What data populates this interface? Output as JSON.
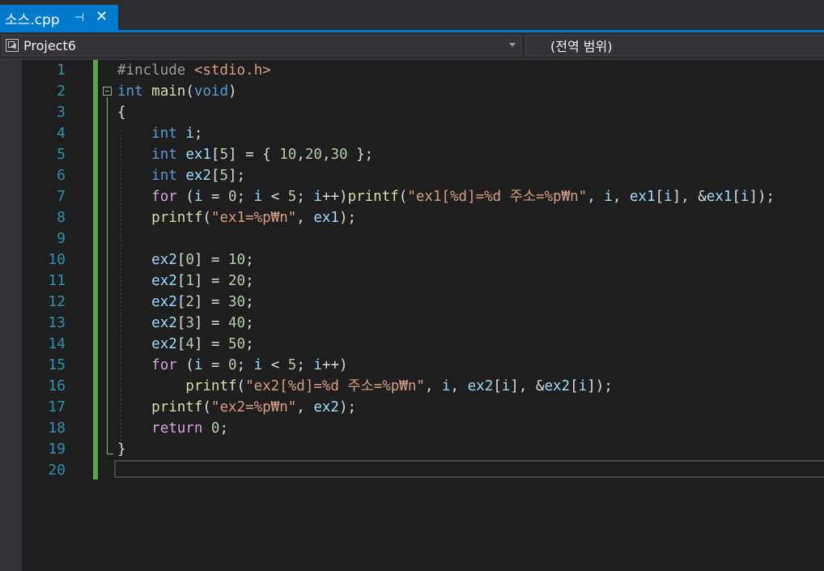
{
  "tab": {
    "title": "소스.cpp",
    "pin_glyph": "⊣",
    "close_glyph": "✕"
  },
  "nav": {
    "project": "Project6",
    "scope": "(전역 범위)"
  },
  "line_numbers": [
    "1",
    "2",
    "3",
    "4",
    "5",
    "6",
    "7",
    "8",
    "9",
    "10",
    "11",
    "12",
    "13",
    "14",
    "15",
    "16",
    "17",
    "18",
    "19",
    "20"
  ],
  "code": [
    [
      {
        "t": "#include ",
        "c": "pp"
      },
      {
        "t": "<stdio.h>",
        "c": "inc"
      }
    ],
    [
      {
        "t": "int",
        "c": "kw"
      },
      {
        "t": " ",
        "c": ""
      },
      {
        "t": "main",
        "c": "fn"
      },
      {
        "t": "(",
        "c": ""
      },
      {
        "t": "void",
        "c": "kw"
      },
      {
        "t": ")",
        "c": ""
      }
    ],
    [
      {
        "t": "{",
        "c": ""
      }
    ],
    [
      {
        "t": "    ",
        "c": ""
      },
      {
        "t": "int",
        "c": "kw"
      },
      {
        "t": " ",
        "c": ""
      },
      {
        "t": "i",
        "c": "var"
      },
      {
        "t": ";",
        "c": ""
      }
    ],
    [
      {
        "t": "    ",
        "c": ""
      },
      {
        "t": "int",
        "c": "kw"
      },
      {
        "t": " ",
        "c": ""
      },
      {
        "t": "ex1",
        "c": "var"
      },
      {
        "t": "[",
        "c": ""
      },
      {
        "t": "5",
        "c": "num"
      },
      {
        "t": "] = { ",
        "c": ""
      },
      {
        "t": "10",
        "c": "num"
      },
      {
        "t": ",",
        "c": ""
      },
      {
        "t": "20",
        "c": "num"
      },
      {
        "t": ",",
        "c": ""
      },
      {
        "t": "30",
        "c": "num"
      },
      {
        "t": " };",
        "c": ""
      }
    ],
    [
      {
        "t": "    ",
        "c": ""
      },
      {
        "t": "int",
        "c": "kw"
      },
      {
        "t": " ",
        "c": ""
      },
      {
        "t": "ex2",
        "c": "var"
      },
      {
        "t": "[",
        "c": ""
      },
      {
        "t": "5",
        "c": "num"
      },
      {
        "t": "];",
        "c": ""
      }
    ],
    [
      {
        "t": "    ",
        "c": ""
      },
      {
        "t": "for",
        "c": "kw2"
      },
      {
        "t": " (",
        "c": ""
      },
      {
        "t": "i",
        "c": "var"
      },
      {
        "t": " = ",
        "c": ""
      },
      {
        "t": "0",
        "c": "num"
      },
      {
        "t": "; ",
        "c": ""
      },
      {
        "t": "i",
        "c": "var"
      },
      {
        "t": " < ",
        "c": ""
      },
      {
        "t": "5",
        "c": "num"
      },
      {
        "t": "; ",
        "c": ""
      },
      {
        "t": "i",
        "c": "var"
      },
      {
        "t": "++)",
        "c": ""
      },
      {
        "t": "printf",
        "c": "fn"
      },
      {
        "t": "(",
        "c": ""
      },
      {
        "t": "\"ex1[%d]=%d 주소=%p₩n\"",
        "c": "str"
      },
      {
        "t": ", ",
        "c": ""
      },
      {
        "t": "i",
        "c": "var"
      },
      {
        "t": ", ",
        "c": ""
      },
      {
        "t": "ex1",
        "c": "var"
      },
      {
        "t": "[",
        "c": ""
      },
      {
        "t": "i",
        "c": "var"
      },
      {
        "t": "], &",
        "c": ""
      },
      {
        "t": "ex1",
        "c": "var"
      },
      {
        "t": "[",
        "c": ""
      },
      {
        "t": "i",
        "c": "var"
      },
      {
        "t": "]);",
        "c": ""
      }
    ],
    [
      {
        "t": "    ",
        "c": ""
      },
      {
        "t": "printf",
        "c": "fn"
      },
      {
        "t": "(",
        "c": ""
      },
      {
        "t": "\"ex1=%p₩n\"",
        "c": "str"
      },
      {
        "t": ", ",
        "c": ""
      },
      {
        "t": "ex1",
        "c": "var"
      },
      {
        "t": ");",
        "c": ""
      }
    ],
    [],
    [
      {
        "t": "    ",
        "c": ""
      },
      {
        "t": "ex2",
        "c": "var"
      },
      {
        "t": "[",
        "c": ""
      },
      {
        "t": "0",
        "c": "num"
      },
      {
        "t": "] = ",
        "c": ""
      },
      {
        "t": "10",
        "c": "num"
      },
      {
        "t": ";",
        "c": ""
      }
    ],
    [
      {
        "t": "    ",
        "c": ""
      },
      {
        "t": "ex2",
        "c": "var"
      },
      {
        "t": "[",
        "c": ""
      },
      {
        "t": "1",
        "c": "num"
      },
      {
        "t": "] = ",
        "c": ""
      },
      {
        "t": "20",
        "c": "num"
      },
      {
        "t": ";",
        "c": ""
      }
    ],
    [
      {
        "t": "    ",
        "c": ""
      },
      {
        "t": "ex2",
        "c": "var"
      },
      {
        "t": "[",
        "c": ""
      },
      {
        "t": "2",
        "c": "num"
      },
      {
        "t": "] = ",
        "c": ""
      },
      {
        "t": "30",
        "c": "num"
      },
      {
        "t": ";",
        "c": ""
      }
    ],
    [
      {
        "t": "    ",
        "c": ""
      },
      {
        "t": "ex2",
        "c": "var"
      },
      {
        "t": "[",
        "c": ""
      },
      {
        "t": "3",
        "c": "num"
      },
      {
        "t": "] = ",
        "c": ""
      },
      {
        "t": "40",
        "c": "num"
      },
      {
        "t": ";",
        "c": ""
      }
    ],
    [
      {
        "t": "    ",
        "c": ""
      },
      {
        "t": "ex2",
        "c": "var"
      },
      {
        "t": "[",
        "c": ""
      },
      {
        "t": "4",
        "c": "num"
      },
      {
        "t": "] = ",
        "c": ""
      },
      {
        "t": "50",
        "c": "num"
      },
      {
        "t": ";",
        "c": ""
      }
    ],
    [
      {
        "t": "    ",
        "c": ""
      },
      {
        "t": "for",
        "c": "kw2"
      },
      {
        "t": " (",
        "c": ""
      },
      {
        "t": "i",
        "c": "var"
      },
      {
        "t": " = ",
        "c": ""
      },
      {
        "t": "0",
        "c": "num"
      },
      {
        "t": "; ",
        "c": ""
      },
      {
        "t": "i",
        "c": "var"
      },
      {
        "t": " < ",
        "c": ""
      },
      {
        "t": "5",
        "c": "num"
      },
      {
        "t": "; ",
        "c": ""
      },
      {
        "t": "i",
        "c": "var"
      },
      {
        "t": "++)",
        "c": ""
      }
    ],
    [
      {
        "t": "        ",
        "c": ""
      },
      {
        "t": "printf",
        "c": "fn"
      },
      {
        "t": "(",
        "c": ""
      },
      {
        "t": "\"ex2[%d]=%d 주소=%p₩n\"",
        "c": "str"
      },
      {
        "t": ", ",
        "c": ""
      },
      {
        "t": "i",
        "c": "var"
      },
      {
        "t": ", ",
        "c": ""
      },
      {
        "t": "ex2",
        "c": "var"
      },
      {
        "t": "[",
        "c": ""
      },
      {
        "t": "i",
        "c": "var"
      },
      {
        "t": "], &",
        "c": ""
      },
      {
        "t": "ex2",
        "c": "var"
      },
      {
        "t": "[",
        "c": ""
      },
      {
        "t": "i",
        "c": "var"
      },
      {
        "t": "]);",
        "c": ""
      }
    ],
    [
      {
        "t": "    ",
        "c": ""
      },
      {
        "t": "printf",
        "c": "fn"
      },
      {
        "t": "(",
        "c": ""
      },
      {
        "t": "\"ex2=%p₩n\"",
        "c": "str"
      },
      {
        "t": ", ",
        "c": ""
      },
      {
        "t": "ex2",
        "c": "var"
      },
      {
        "t": ");",
        "c": ""
      }
    ],
    [
      {
        "t": "    ",
        "c": ""
      },
      {
        "t": "return",
        "c": "kw2"
      },
      {
        "t": " ",
        "c": ""
      },
      {
        "t": "0",
        "c": "num"
      },
      {
        "t": ";",
        "c": ""
      }
    ],
    [
      {
        "t": "}",
        "c": ""
      }
    ],
    []
  ]
}
